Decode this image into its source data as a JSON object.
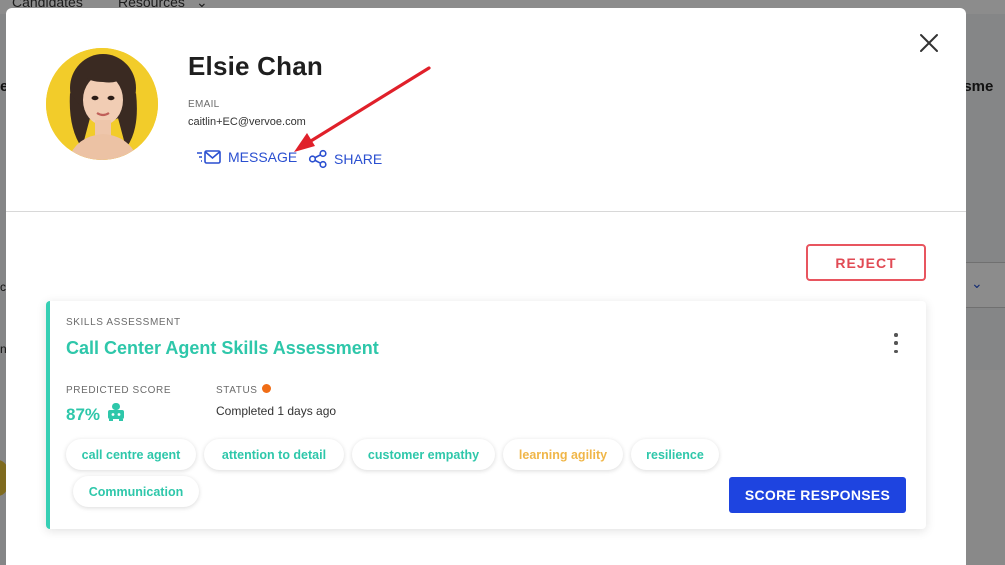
{
  "background": {
    "nav_items": [
      "Candidates",
      "Resources"
    ],
    "right_heading_fragment": "ssme",
    "left_fragments": [
      "e",
      "c",
      "ng"
    ]
  },
  "profile": {
    "name": "Elsie Chan",
    "email_label": "EMAIL",
    "email": "caitlin+EC@vervoe.com",
    "actions": {
      "message_label": "MESSAGE",
      "share_label": "SHARE"
    }
  },
  "reject_label": "REJECT",
  "assessment": {
    "kicker": "SKILLS ASSESSMENT",
    "title": "Call Center Agent Skills Assessment",
    "predicted_score_label": "PREDICTED SCORE",
    "predicted_score": "87%",
    "status_label": "STATUS",
    "status_value": "Completed 1 days ago",
    "tags": [
      {
        "label": "call centre agent"
      },
      {
        "label": "attention to detail"
      },
      {
        "label": "customer empathy"
      },
      {
        "label": "learning agility"
      },
      {
        "label": "resilience"
      },
      {
        "label": "Communication"
      }
    ],
    "score_button_label": "SCORE RESPONSES"
  },
  "colors": {
    "accent_teal": "#2ec7aa",
    "primary_blue": "#1e44e0",
    "link_blue": "#2a4fd0",
    "reject_red": "#e14a54",
    "status_orange": "#f06d16",
    "tag_warn": "#f0b648",
    "annotation_arrow": "#e0202a"
  }
}
